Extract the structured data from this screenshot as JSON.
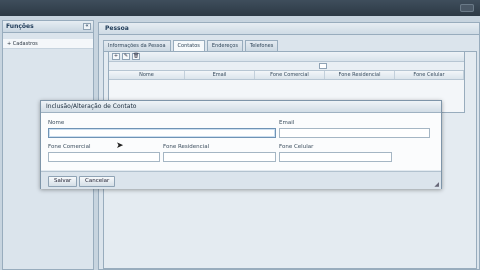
{
  "sidebar": {
    "title": "Funções",
    "collapse_glyph": "«",
    "items": [
      {
        "label": "Cadastros",
        "expander": "+"
      }
    ]
  },
  "main": {
    "title": "Pessoa",
    "tabs": [
      {
        "label": "Informações da Pessoa",
        "active": false
      },
      {
        "label": "Contatos",
        "active": true
      },
      {
        "label": "Endereços",
        "active": false
      },
      {
        "label": "Telefones",
        "active": false
      }
    ],
    "grid": {
      "toolbar": [
        "+",
        "✎",
        "🗑"
      ],
      "columns": [
        "Nome",
        "Email",
        "Fone Comercial",
        "Fone Residencial",
        "Fone Celular"
      ]
    }
  },
  "dialog": {
    "title": "Inclusão/Alteração de Contato",
    "fields": {
      "nome_label": "Nome",
      "email_label": "Email",
      "fone_comercial_label": "Fone Comercial",
      "fone_residencial_label": "Fone Residencial",
      "fone_celular_label": "Fone Celular"
    },
    "buttons": {
      "save": "Salvar",
      "cancel": "Cancelar"
    }
  },
  "icons": {
    "cursor": "pointer-cursor-icon",
    "resize": "resize-grip-icon"
  }
}
